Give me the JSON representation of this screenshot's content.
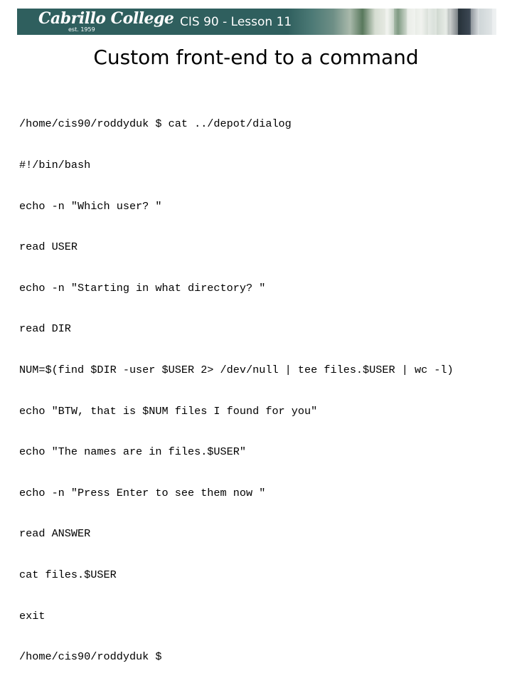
{
  "header": {
    "logo_text": "Cabrillo College",
    "logo_subtext": "est. 1959",
    "course_title": "CIS 90 - Lesson 11",
    "banner_color": "#2f5f5e"
  },
  "slide": {
    "title": "Custom front-end to a command",
    "terminal_lines": [
      "/home/cis90/roddyduk $ cat ../depot/dialog",
      "#!/bin/bash",
      "echo -n \"Which user? \"",
      "read USER",
      "echo -n \"Starting in what directory? \"",
      "read DIR",
      "NUM=$(find $DIR -user $USER 2> /dev/null | tee files.$USER | wc -l)",
      "echo \"BTW, that is $NUM files I found for you\"",
      "echo \"The names are in files.$USER\"",
      "echo -n \"Press Enter to see them now \"",
      "read ANSWER",
      "cat files.$USER",
      "exit",
      "/home/cis90/roddyduk $"
    ]
  }
}
